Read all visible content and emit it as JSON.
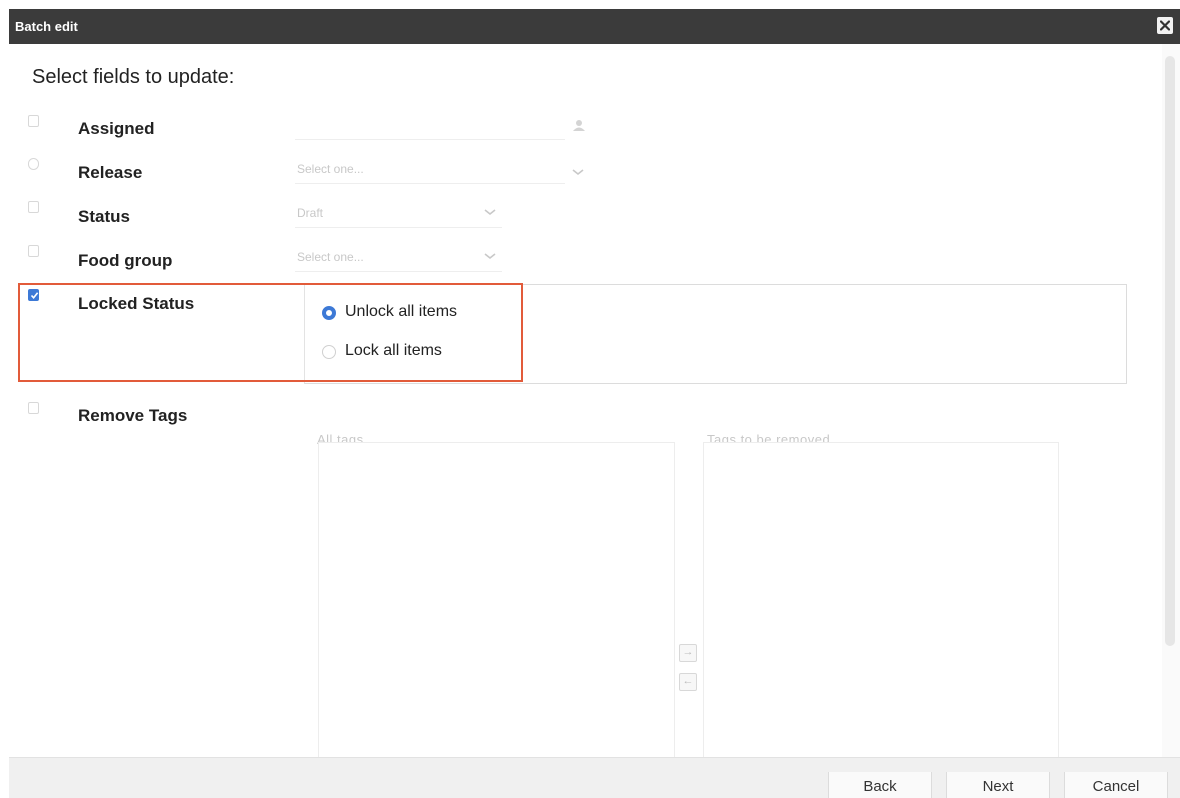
{
  "dialog": {
    "title": "Batch edit",
    "heading": "Select fields to update:"
  },
  "fields": {
    "assigned": {
      "label": "Assigned",
      "checked": false,
      "value": ""
    },
    "release": {
      "label": "Release",
      "checked": false,
      "placeholder": "Select one..."
    },
    "status": {
      "label": "Status",
      "checked": false,
      "value": "Draft"
    },
    "food_group": {
      "label": "Food group",
      "checked": false,
      "placeholder": "Select one..."
    },
    "locked_status": {
      "label": "Locked Status",
      "checked": true,
      "options": [
        {
          "label": "Unlock all items",
          "selected": true
        },
        {
          "label": "Lock all items",
          "selected": false
        }
      ]
    },
    "remove_tags": {
      "label": "Remove Tags",
      "checked": false,
      "all_tags_label": "All tags",
      "to_remove_label": "Tags to be removed"
    }
  },
  "footer": {
    "back_label": "Back",
    "next_label": "Next",
    "cancel_label": "Cancel"
  },
  "colors": {
    "titlebar": "#3b3b3b",
    "accent": "#3d79d6",
    "highlight": "#e25b3a"
  }
}
